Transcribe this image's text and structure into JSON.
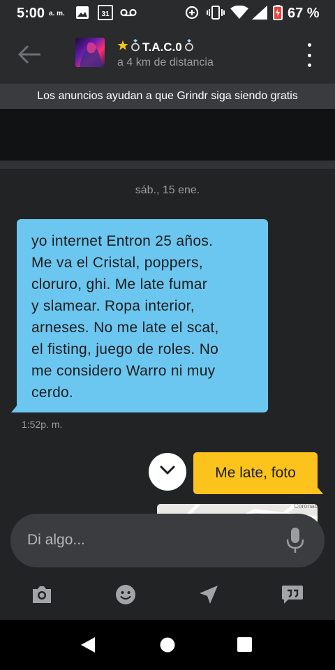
{
  "status_bar": {
    "time": "5:00",
    "ampm": "a. m.",
    "calendar_day": "31",
    "battery_percent": "67 %",
    "icons": [
      "image-icon",
      "calendar-icon",
      "voicemail-icon",
      "data-saver-icon",
      "vibrate-icon",
      "wifi-icon",
      "signal-icon",
      "battery-icon"
    ]
  },
  "header": {
    "profile_name": "T.A.C.0",
    "distance": "a 4 km de distancia",
    "icons": [
      "back-arrow-icon",
      "star-icon",
      "ring-icon",
      "ring-icon",
      "more-vert-icon"
    ],
    "colors": {
      "star": "#f5c518",
      "background": "#2a2b2d"
    }
  },
  "ad": {
    "banner_text": "Los anuncios ayudan a que Grindr siga siendo gratis"
  },
  "chat": {
    "date_separator": "sáb., 15 ene.",
    "messages": [
      {
        "direction": "incoming",
        "lines": [
          "yo internet Entron 25 años.",
          "Me va el Cristal, poppers,",
          "cloruro, ghi. Me late fumar",
          "y slamear. Ropa interior,",
          "arneses. No me late el scat,",
          "el fisting, juego de roles. No",
          "me considero Warro ni muy",
          "cerdo."
        ],
        "time": "1:52p. m.",
        "color": "#6bc7ef"
      },
      {
        "direction": "outgoing",
        "text": "Me late, foto",
        "color": "#fcc31c"
      }
    ],
    "map_label": "Coronac"
  },
  "input": {
    "placeholder": "Di algo...",
    "mic_icon": "microphone-icon"
  },
  "toolbar": {
    "icons": [
      "camera-icon",
      "emoji-icon",
      "location-icon",
      "saved-phrases-icon"
    ]
  },
  "nav_bar": {
    "icons": [
      "nav-back-icon",
      "nav-home-icon",
      "nav-recents-icon"
    ]
  }
}
